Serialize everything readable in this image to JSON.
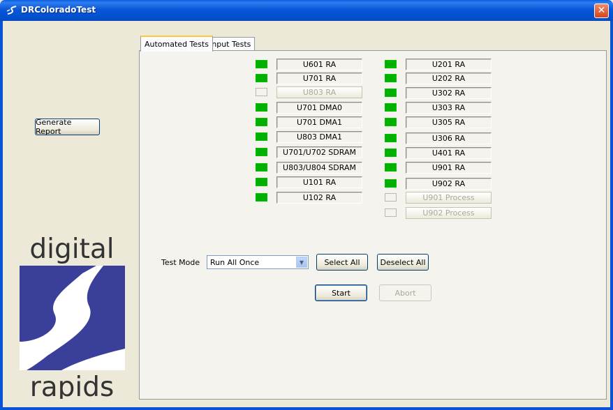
{
  "window": {
    "title": "DRColoradoTest",
    "close_glyph": "✕"
  },
  "left": {
    "generate_report_label": "Generate Report"
  },
  "logo": {
    "top_text": "digital",
    "bottom_text": "rapids"
  },
  "tabs": [
    {
      "label": "Automated Tests",
      "active": true
    },
    {
      "label": "Input Tests",
      "active": false
    }
  ],
  "tests_left": [
    {
      "label": "U601 RA",
      "enabled": true
    },
    {
      "label": "U701 RA",
      "enabled": true
    },
    {
      "label": "U803 RA",
      "enabled": false
    },
    {
      "label": "U701 DMA0",
      "enabled": true
    },
    {
      "label": "U701 DMA1",
      "enabled": true
    },
    {
      "label": "U803 DMA1",
      "enabled": true
    },
    {
      "label": "U701/U702 SDRAM",
      "enabled": true
    },
    {
      "label": "U803/U804 SDRAM",
      "enabled": true
    },
    {
      "label": "U101 RA",
      "enabled": true
    },
    {
      "label": "U102 RA",
      "enabled": true
    }
  ],
  "tests_right": [
    {
      "label": "U201 RA",
      "enabled": true
    },
    {
      "label": "U202 RA",
      "enabled": true
    },
    {
      "label": "U302 RA",
      "enabled": true
    },
    {
      "label": "U303 RA",
      "enabled": true
    },
    {
      "label": "U305 RA",
      "enabled": true
    },
    {
      "label": "U306 RA",
      "enabled": true
    },
    {
      "label": "U401 RA",
      "enabled": true
    },
    {
      "label": "U901 RA",
      "enabled": true
    },
    {
      "label": "U902 RA",
      "enabled": true
    },
    {
      "label": "U901 Process",
      "enabled": false
    },
    {
      "label": "U902 Process",
      "enabled": false
    }
  ],
  "controls": {
    "test_mode_label": "Test Mode",
    "test_mode_value": "Run All Once",
    "select_all_label": "Select All",
    "deselect_all_label": "Deselect All",
    "start_label": "Start",
    "abort_label": "Abort"
  },
  "colors": {
    "led_on": "#00B000",
    "logo_blue": "#3A3F99",
    "titlebar": "#0A57D8"
  }
}
